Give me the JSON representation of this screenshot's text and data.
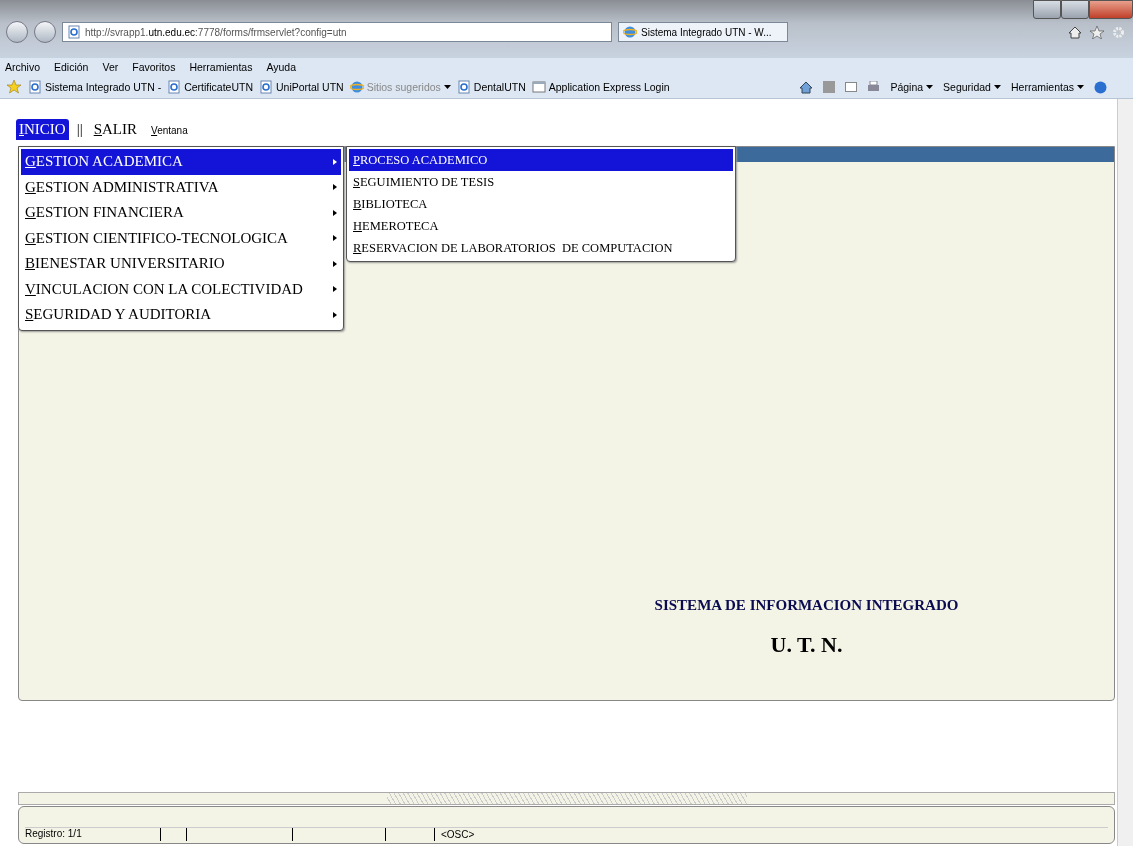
{
  "browser": {
    "address": "http://svrapp1.**utn.edu.ec**:7778/forms/frmservlet?config=utn",
    "tab": "Sistema Integrado UTN - W...",
    "menu": [
      "Archivo",
      "Edición",
      "Ver",
      "Favoritos",
      "Herramientas",
      "Ayuda"
    ],
    "favorites": [
      {
        "label": "Sistema Integrado UTN -",
        "kind": "page"
      },
      {
        "label": "CertificateUTN",
        "kind": "page"
      },
      {
        "label": "UniPortal UTN",
        "kind": "page"
      },
      {
        "label": "Sitios sugeridos",
        "kind": "suggested"
      },
      {
        "label": "DentalUTN",
        "kind": "page"
      },
      {
        "label": "Application Express Login",
        "kind": "window"
      }
    ],
    "commands": [
      "Página",
      "Seguridad",
      "Herramientas"
    ]
  },
  "app": {
    "menubar": [
      {
        "label": "INICIO",
        "selected": true
      },
      {
        "label": "||",
        "kind": "separator"
      },
      {
        "label": "SALIR",
        "selected": false
      },
      {
        "label": "Ventana",
        "kind": "small"
      }
    ],
    "menu": [
      {
        "label": "GESTION ACADEMICA",
        "selected": true
      },
      {
        "label": "GESTION ADMINISTRATIVA",
        "selected": false
      },
      {
        "label": "GESTION FINANCIERA",
        "selected": false
      },
      {
        "label": "GESTION CIENTIFICO-TECNOLOGICA",
        "selected": false
      },
      {
        "label": "BIENESTAR UNIVERSITARIO",
        "selected": false
      },
      {
        "label": "VINCULACION CON LA COLECTIVIDAD",
        "selected": false
      },
      {
        "label": "SEGURIDAD Y AUDITORIA",
        "selected": false
      }
    ],
    "submenu": [
      {
        "label": "PROCESO ACADEMICO",
        "selected": true
      },
      {
        "label": "SEGUIMIENTO DE TESIS",
        "selected": false
      },
      {
        "label": "BIBLIOTECA",
        "selected": false
      },
      {
        "label": "HEMEROTECA",
        "selected": false
      },
      {
        "label": "RESERVACION DE LABORATORIOS  DE COMPUTACION",
        "selected": false
      }
    ],
    "title": "SISTEMA DE INFORMACION INTEGRADO",
    "subtitle": "U. T. N.",
    "status": {
      "record": "Registro: 1/1",
      "mode": "<OSC>"
    }
  }
}
